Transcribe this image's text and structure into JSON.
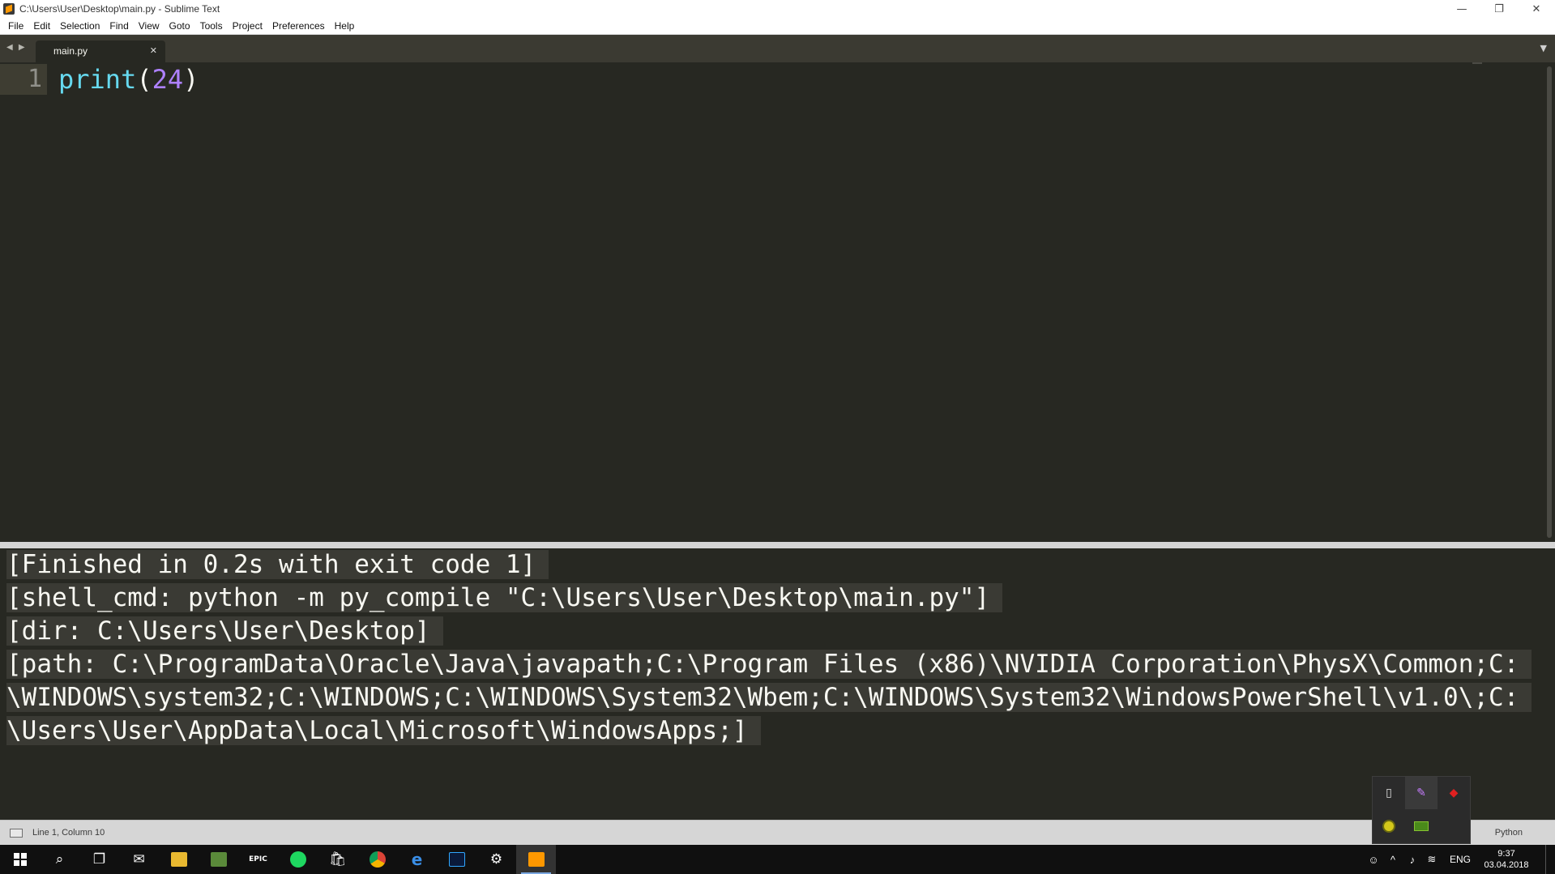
{
  "window": {
    "title": "C:\\Users\\User\\Desktop\\main.py - Sublime Text",
    "minimize": "—",
    "restore": "❐",
    "close": "✕"
  },
  "menu": {
    "file": "File",
    "edit": "Edit",
    "selection": "Selection",
    "find": "Find",
    "view": "View",
    "goto": "Goto",
    "tools": "Tools",
    "project": "Project",
    "preferences": "Preferences",
    "help": "Help"
  },
  "tabs": {
    "nav": "◀ ▶",
    "active": "main.py",
    "close": "✕",
    "dropdown": "▼"
  },
  "editor": {
    "line_number": "1",
    "code": {
      "fn": "print",
      "open": "(",
      "num": "24",
      "close": ")"
    }
  },
  "output": {
    "lines": [
      "[Finished in 0.2s with exit code 1]",
      "[shell_cmd: python -m py_compile \"C:\\Users\\User\\Desktop\\main.py\"]",
      "[dir: C:\\Users\\User\\Desktop]",
      "[path: C:\\ProgramData\\Oracle\\Java\\javapath;C:\\Program Files (x86)\\NVIDIA Corporation\\PhysX\\Common;C:",
      "\\WINDOWS\\system32;C:\\WINDOWS;C:\\WINDOWS\\System32\\Wbem;C:\\WINDOWS\\System32\\WindowsPowerShell\\v1.0\\;C:",
      "\\Users\\User\\AppData\\Local\\Microsoft\\WindowsApps;]"
    ]
  },
  "status": {
    "position": "Line 1, Column 10",
    "syntax": "Python"
  },
  "taskbar": {
    "lang": "ENG",
    "time": "9:37",
    "date": "03.04.2018",
    "epic_label": "EPIC"
  },
  "colors": {
    "editor_bg": "#272822",
    "function": "#66d9ef",
    "number": "#ae81ff"
  }
}
